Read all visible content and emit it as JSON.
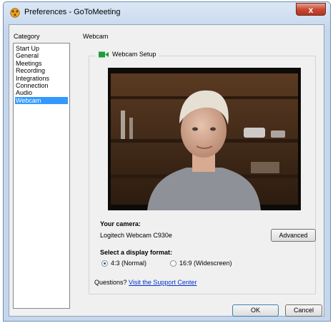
{
  "window": {
    "title": "Preferences - GoToMeeting",
    "close_glyph": "x"
  },
  "category": {
    "heading": "Category",
    "items": [
      "Start Up",
      "General",
      "Meetings",
      "Recording",
      "Integrations",
      "Connection",
      "Audio",
      "Webcam"
    ],
    "selected": "Webcam"
  },
  "panel": {
    "heading": "Webcam",
    "group_title": "Webcam Setup",
    "camera_label": "Your camera:",
    "camera_name": "Logitech Webcam C930e",
    "advanced_button": "Advanced",
    "format_label": "Select a display format:",
    "format_options": [
      "4:3 (Normal)",
      "16:9 (Widescreen)"
    ],
    "format_selected": "4:3 (Normal)",
    "questions_text": "Questions?",
    "support_link": "Visit the Support Center"
  },
  "footer": {
    "ok_button": "OK",
    "cancel_button": "Cancel"
  },
  "icons": {
    "app": "gotomeeting-gear-icon",
    "webcam": "webcam-icon"
  },
  "colors": {
    "selection": "#3399ff",
    "webcam_icon": "#1f9d37",
    "close_button": "#c74b35",
    "link": "#0033cc"
  }
}
